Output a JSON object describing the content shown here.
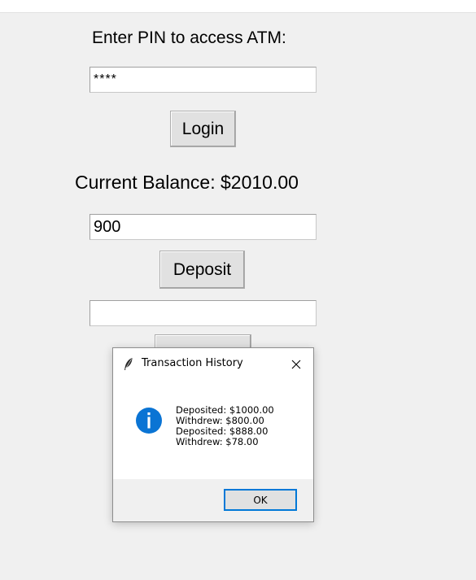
{
  "atm": {
    "pin_label": "Enter PIN to access ATM:",
    "pin_value": "****",
    "login_label": "Login",
    "balance_label": "Current Balance: $2010.00",
    "amount_value": "900",
    "deposit_label": "Deposit",
    "withdraw_value": ""
  },
  "dialog": {
    "title": "Transaction History",
    "messages": [
      "Deposited: $1000.00",
      "Withdrew: $800.00",
      "Deposited: $888.00",
      "Withdrew: $78.00"
    ],
    "ok_label": "OK",
    "icons": {
      "app": "feather-icon",
      "close": "close-icon",
      "message": "info-icon"
    }
  },
  "colors": {
    "window_bg": "#f0f0f0",
    "info_blue": "#0a74d4",
    "focus_border": "#0078d7"
  }
}
